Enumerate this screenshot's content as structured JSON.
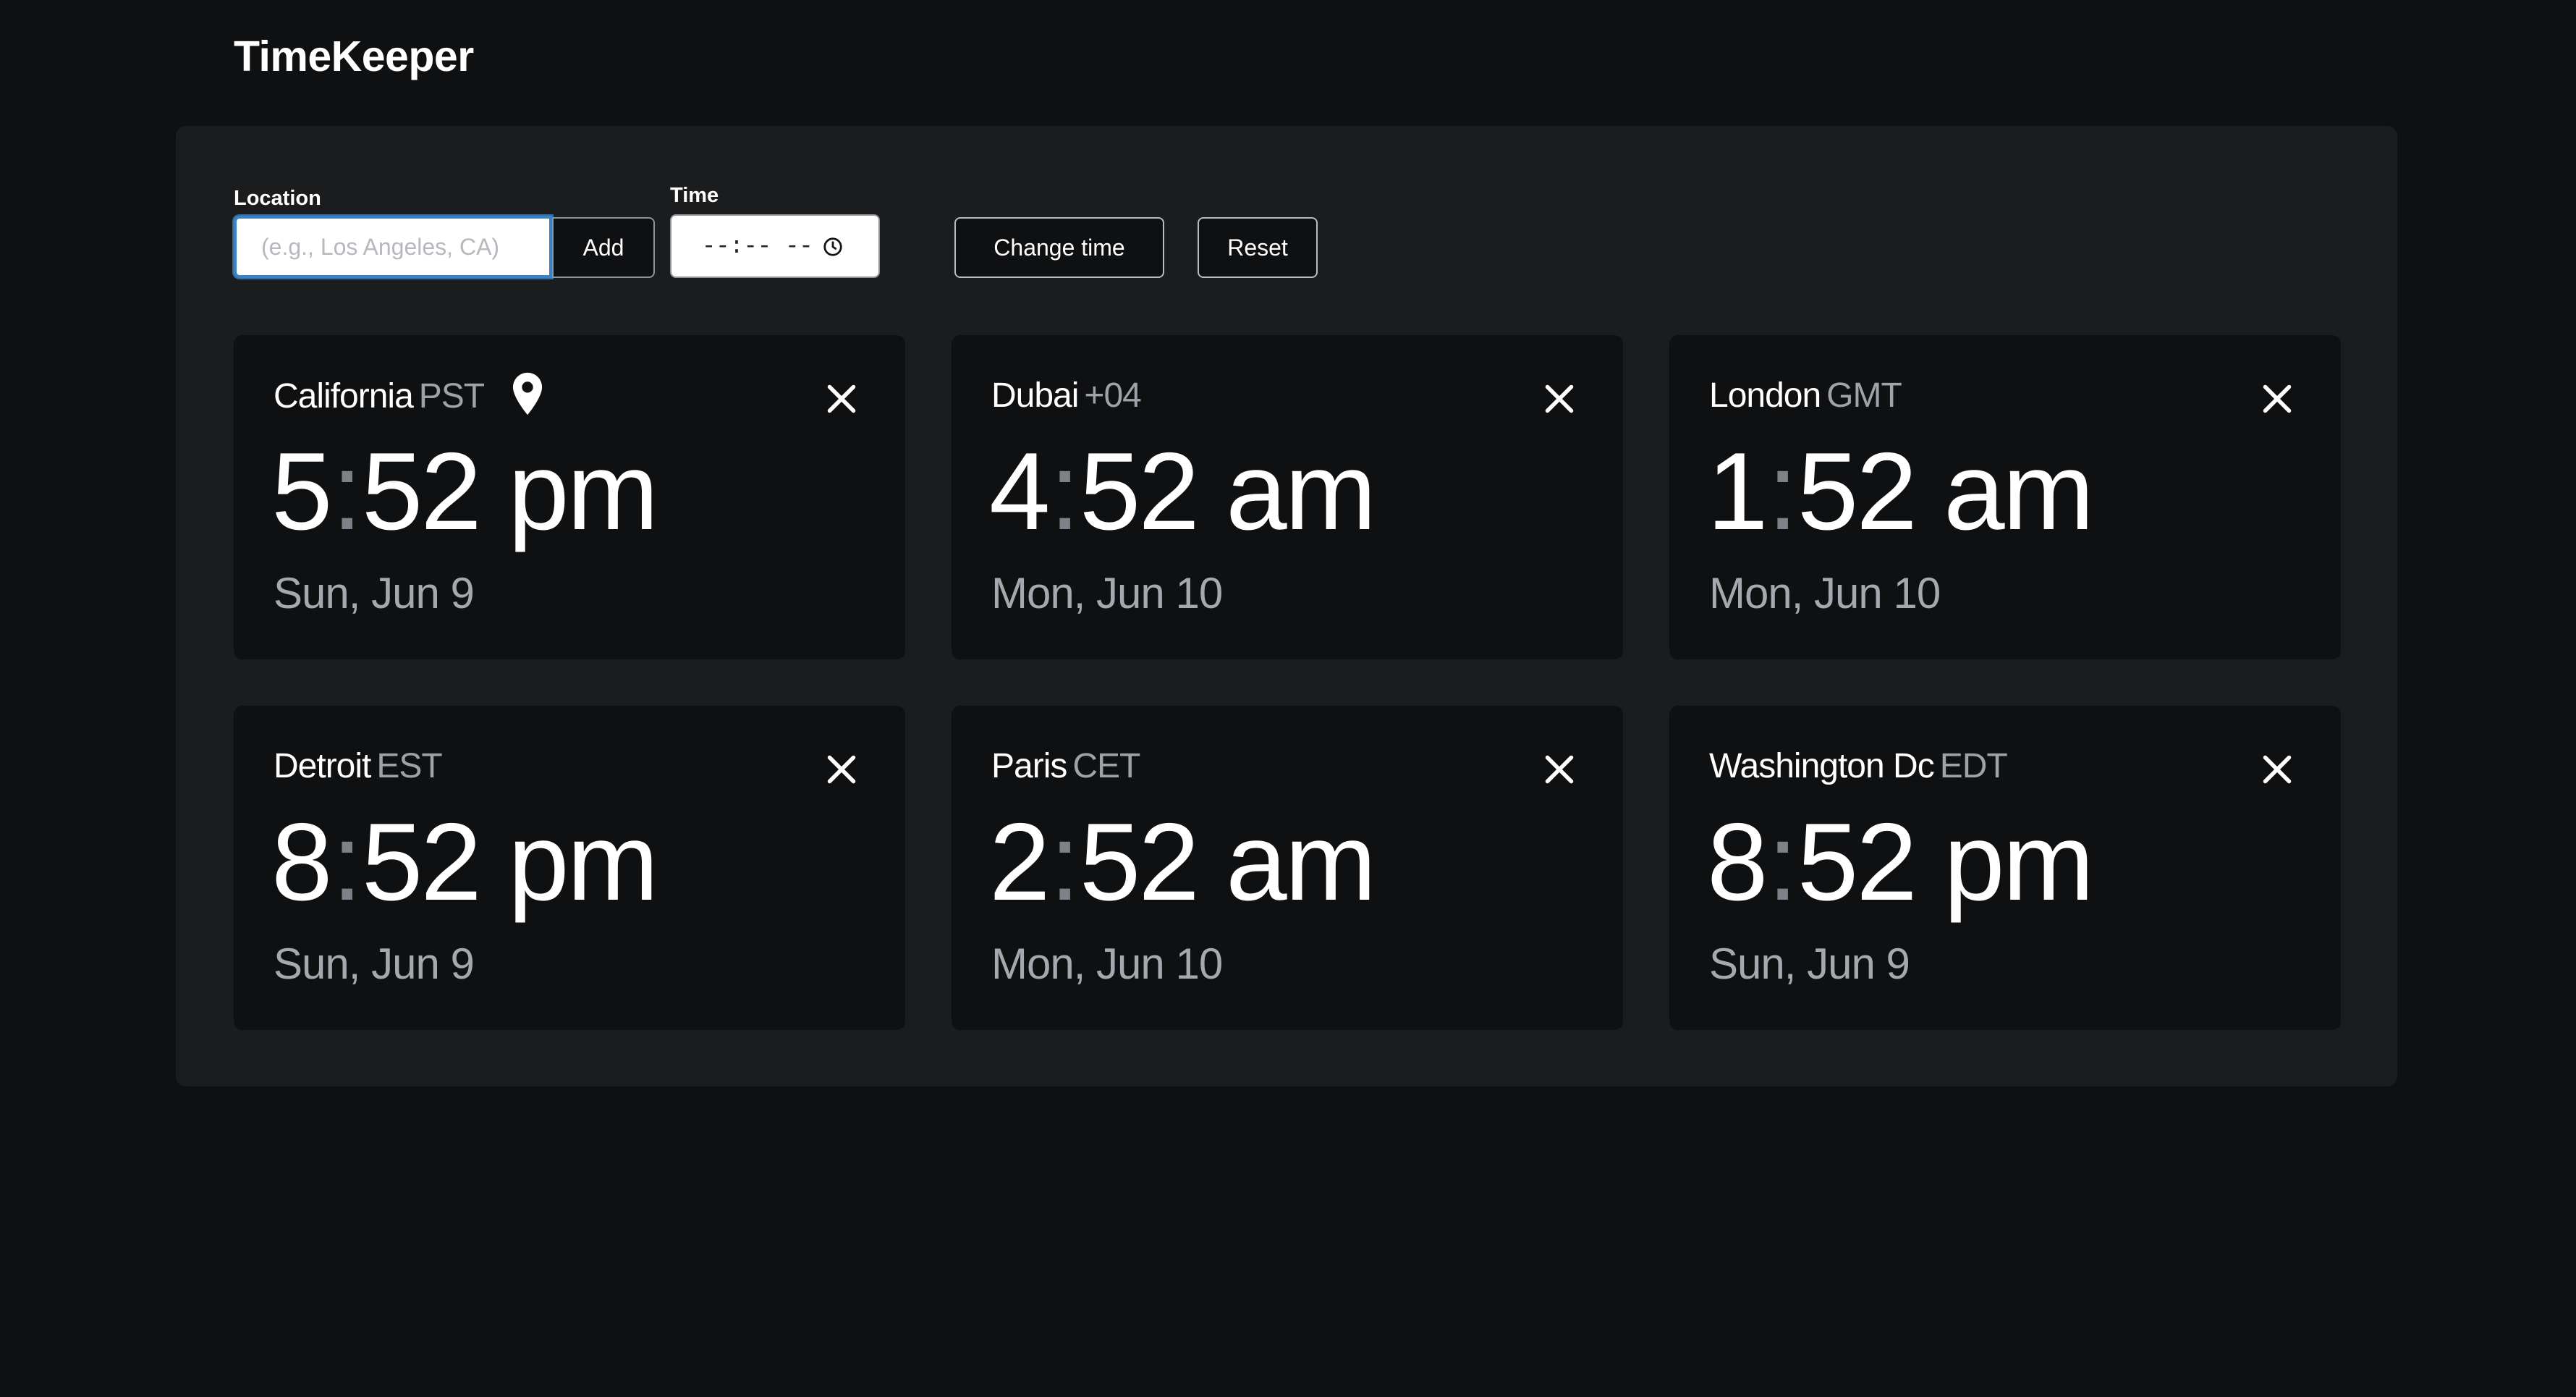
{
  "app": {
    "title": "TimeKeeper"
  },
  "controls": {
    "location_label": "Location",
    "location_placeholder": "(e.g., Los Angeles, CA)",
    "location_value": "",
    "add_label": "Add",
    "time_label": "Time",
    "time_value": "--:-- --",
    "change_time_label": "Change time",
    "reset_label": "Reset"
  },
  "cards": [
    {
      "city": "California",
      "tz": "PST",
      "hour": "5",
      "minute": "52",
      "ampm": "pm",
      "date": "Sun, Jun 9",
      "is_current_location": true
    },
    {
      "city": "Dubai",
      "tz": "+04",
      "hour": "4",
      "minute": "52",
      "ampm": "am",
      "date": "Mon, Jun 10",
      "is_current_location": false
    },
    {
      "city": "London",
      "tz": "GMT",
      "hour": "1",
      "minute": "52",
      "ampm": "am",
      "date": "Mon, Jun 10",
      "is_current_location": false
    },
    {
      "city": "Detroit",
      "tz": "EST",
      "hour": "8",
      "minute": "52",
      "ampm": "pm",
      "date": "Sun, Jun 9",
      "is_current_location": false
    },
    {
      "city": "Paris",
      "tz": "CET",
      "hour": "2",
      "minute": "52",
      "ampm": "am",
      "date": "Mon, Jun 10",
      "is_current_location": false
    },
    {
      "city": "Washington Dc",
      "tz": "EDT",
      "hour": "8",
      "minute": "52",
      "ampm": "pm",
      "date": "Sun, Jun 9",
      "is_current_location": false
    }
  ],
  "icons": {
    "location_pin": "map-pin-icon",
    "close": "close-icon",
    "clock": "clock-icon"
  },
  "colors": {
    "background": "#0f1012",
    "panel": "#1b1c1e",
    "card": "#0f1012",
    "muted_text": "#9ea3aa",
    "focus_ring": "#3b82c4"
  }
}
